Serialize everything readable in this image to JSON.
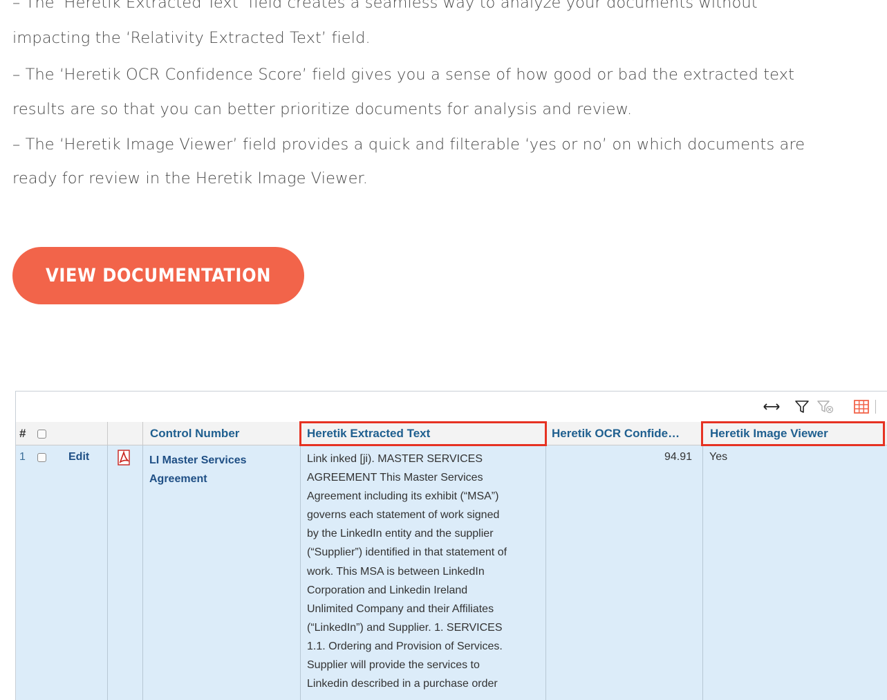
{
  "intro": {
    "lines": [
      "– The ‘Heretik Extracted Text’ field creates a seamless way to analyze your documents without",
      "impacting the ‘Relativity Extracted Text’ field.",
      "– The ‘Heretik OCR Confidence Score’ field gives you a sense of how good or bad the extracted text",
      "results are so that you can better prioritize documents for analysis and review.",
      "– The ‘Heretik Image Viewer’ field provides a quick and filterable ‘yes or no’ on which documents are",
      "ready for review in the Heretik Image Viewer."
    ]
  },
  "cta": {
    "label": "VIEW DOCUMENTATION"
  },
  "colors": {
    "cta": "#f2644a",
    "highlight": "#e63222",
    "row_bg": "#dcecf9",
    "header_text": "#1f5f8f"
  },
  "toolbar": {
    "icons": [
      "expand-width-icon",
      "filter-icon",
      "clear-filter-icon",
      "grid-icon"
    ]
  },
  "grid": {
    "columns": {
      "num": "#",
      "control_number": "Control Number",
      "extracted_text": "Heretik Extracted Text",
      "ocr_confidence": "Heretik OCR Confide…",
      "image_viewer": "Heretik Image Viewer"
    },
    "rows": [
      {
        "num": "1",
        "edit": "Edit",
        "file_type_icon": "pdf-icon",
        "control_number_line1": "LI Master Services",
        "control_number_line2": "Agreement",
        "extracted_text_lines": [
          "Link inked [ji). MASTER SERVICES",
          "AGREEMENT This Master Services",
          "Agreement including its exhibit (“MSA”)",
          "governs each statement of work signed",
          "by the LinkedIn entity and the supplier",
          "(“Supplier”) identified in that statement of",
          "work. This MSA is between LinkedIn",
          "Corporation and Linkedin Ireland",
          "Unlimited Company and their Affiliates",
          "(“LinkedIn”) and Supplier. 1. SERVICES",
          "1.1. Ordering and Provision of Services.",
          "Supplier will provide the services to",
          "Linkedin described in a purchase order"
        ],
        "ocr_confidence": "94.91",
        "image_viewer": "Yes"
      }
    ]
  }
}
